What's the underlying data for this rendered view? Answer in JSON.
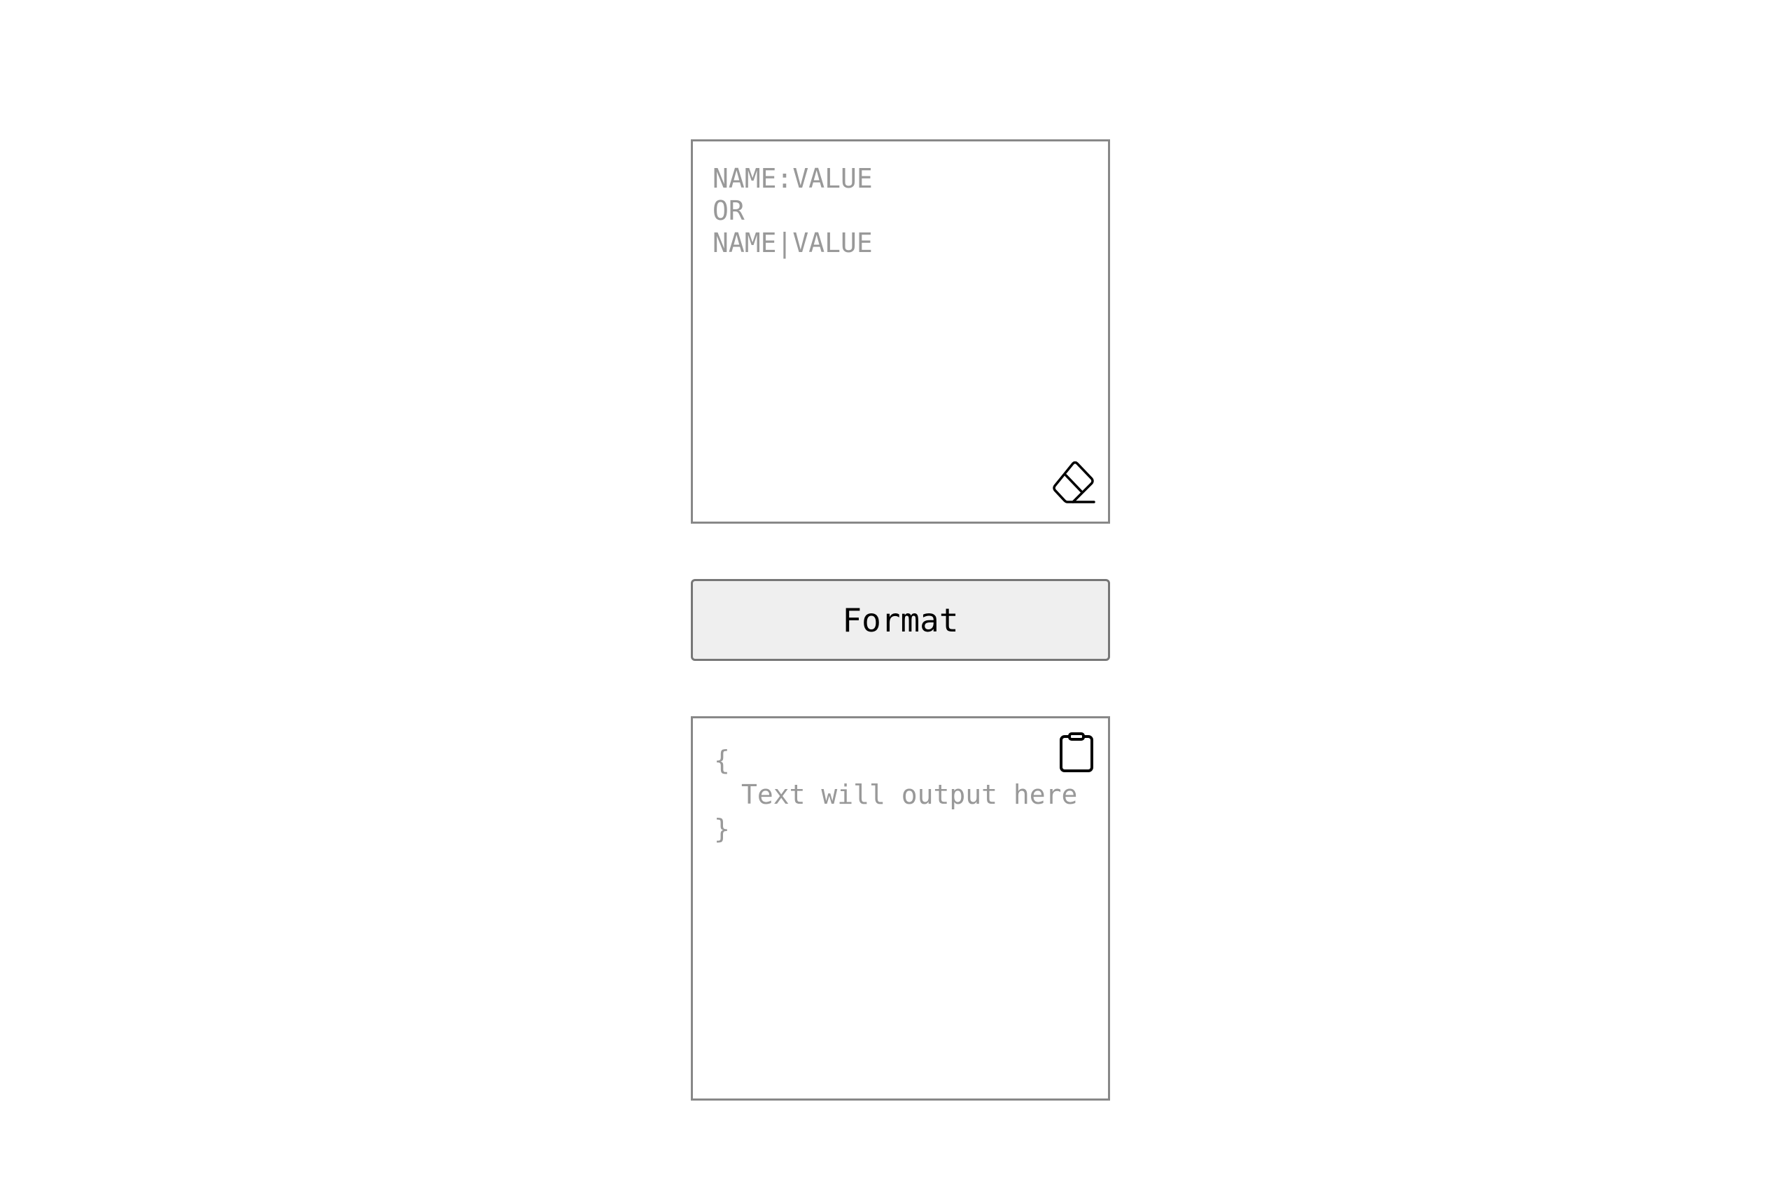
{
  "input": {
    "placeholder_lines": [
      "NAME:VALUE",
      "OR",
      "NAME|VALUE"
    ],
    "clear_icon": "eraser-icon"
  },
  "format_button": {
    "label": "Format"
  },
  "output": {
    "lines": [
      "{",
      "Text will output here",
      "}"
    ],
    "copy_icon": "clipboard-icon"
  }
}
